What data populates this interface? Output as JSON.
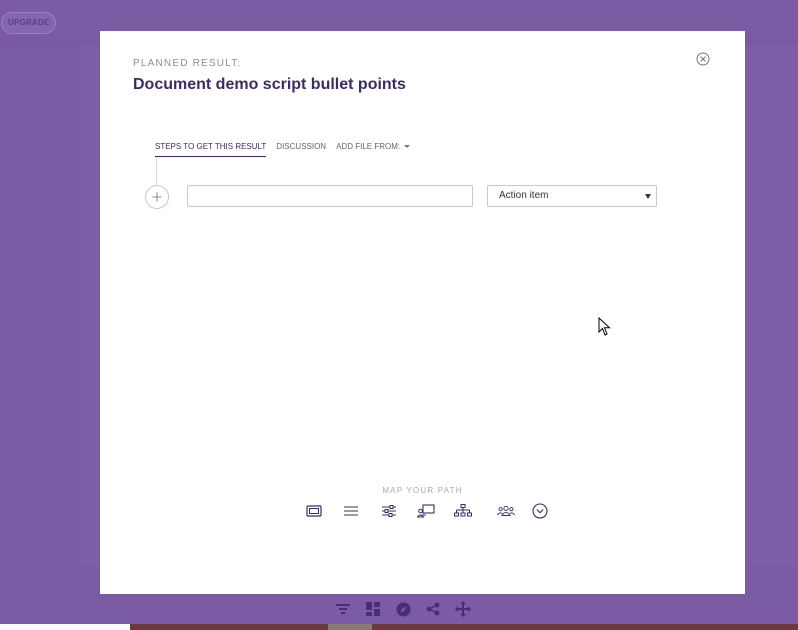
{
  "header": {
    "upgrade_label": "UPGRADE"
  },
  "modal": {
    "planned_label": "PLANNED RESULT:",
    "title": "Document demo script bullet points",
    "tabs": [
      {
        "label": "STEPS TO GET THIS RESULT",
        "active": true
      },
      {
        "label": "DISCUSSION",
        "active": false
      },
      {
        "label": "ADD FILE FROM:",
        "active": false
      }
    ],
    "step_input": {
      "value": "",
      "placeholder": ""
    },
    "type_select": {
      "selected": "Action item"
    },
    "map_label": "MAP YOUR PATH",
    "map_icons": [
      "card-view-icon",
      "list-view-icon",
      "sliders-icon",
      "presentation-icon",
      "org-chart-icon",
      "people-icon",
      "more-options-icon"
    ]
  },
  "bottom_toolbar": {
    "icons": [
      "filter-icon",
      "dashboard-icon",
      "compass-icon",
      "share-icon",
      "move-icon"
    ]
  },
  "colors": {
    "backdrop": "#7b5ba3",
    "accent": "#3f2a68",
    "modal_bg": "#ffffff"
  }
}
